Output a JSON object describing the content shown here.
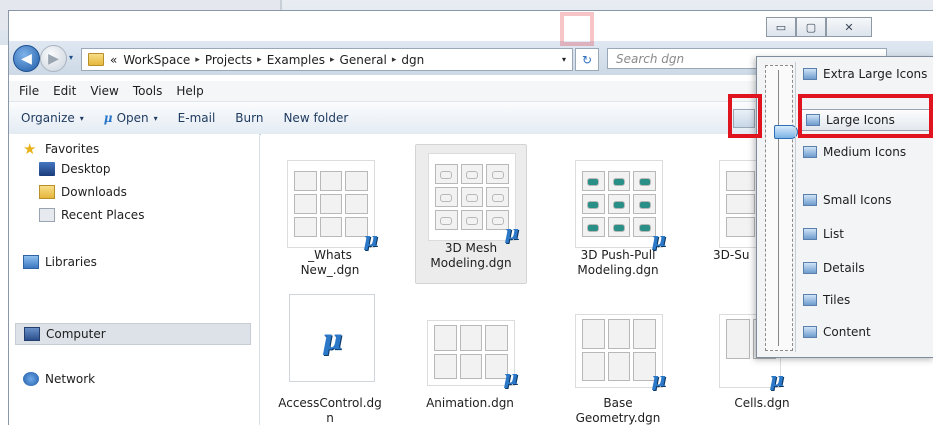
{
  "caption_buttons": {
    "minimize": "▭",
    "maximize": "▢",
    "close": "✕"
  },
  "address": {
    "overflow": "«",
    "crumbs": [
      "WorkSpace",
      "Projects",
      "Examples",
      "General",
      "dgn"
    ],
    "separator": "▸",
    "dropdown": "▾",
    "refresh": "↻",
    "search_placeholder": "Search dgn"
  },
  "menubar": [
    "File",
    "Edit",
    "View",
    "Tools",
    "Help"
  ],
  "toolbar": {
    "organize": "Organize",
    "open": "Open",
    "open_logo": "μ",
    "email": "E-mail",
    "burn": "Burn",
    "new_folder": "New folder",
    "caret": "▾"
  },
  "navpane": {
    "favorites": "Favorites",
    "desktop": "Desktop",
    "downloads": "Downloads",
    "recent_places": "Recent Places",
    "libraries": "Libraries",
    "computer": "Computer",
    "network": "Network"
  },
  "files": [
    {
      "name": "_Whats\nNew_.dgn"
    },
    {
      "name": "3D Mesh\nModeling.dgn"
    },
    {
      "name": "3D Push-Pull\nModeling.dgn"
    },
    {
      "name": "3D-Su"
    },
    {
      "name": "AccessControl.dg\nn"
    },
    {
      "name": "Animation.dgn"
    },
    {
      "name": "Base\nGeometry.dgn"
    },
    {
      "name": "Cells.dgn"
    }
  ],
  "view_menu": {
    "options": [
      "Extra Large Icons",
      "Large Icons",
      "Medium Icons",
      "Small Icons",
      "List",
      "Details",
      "Tiles",
      "Content"
    ],
    "selected": "Large Icons"
  },
  "accent_color": "#e0141e",
  "icons": {
    "back": "◀",
    "forward": "▶",
    "favorites": "★",
    "microstation": "μ"
  }
}
